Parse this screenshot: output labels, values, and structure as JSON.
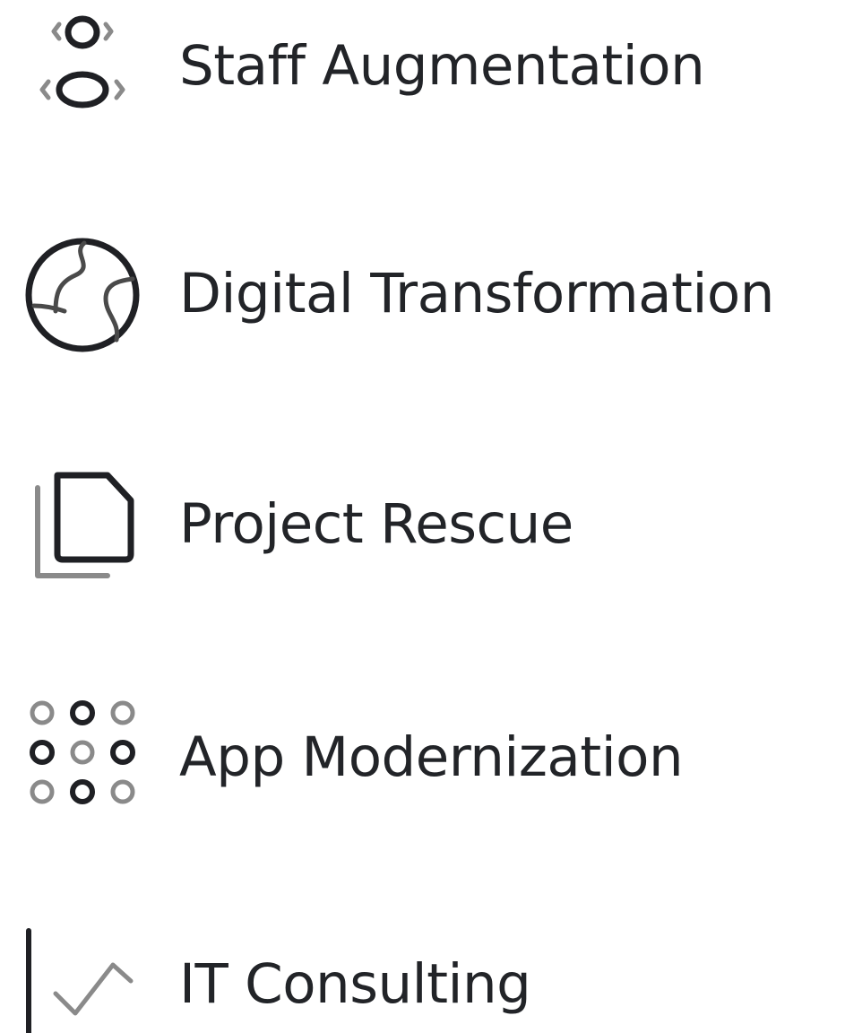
{
  "menu": {
    "items": [
      {
        "label": "Staff Augmentation",
        "icon": "people-code-icon"
      },
      {
        "label": "Digital Transformation",
        "icon": "globe-path-icon"
      },
      {
        "label": "Project Rescue",
        "icon": "documents-icon"
      },
      {
        "label": "App Modernization",
        "icon": "dot-grid-icon"
      },
      {
        "label": "IT Consulting",
        "icon": "line-chart-icon"
      }
    ]
  },
  "colors": {
    "text": "#222428",
    "icon_dark": "#1f2024",
    "icon_light": "#8a8a8a"
  }
}
